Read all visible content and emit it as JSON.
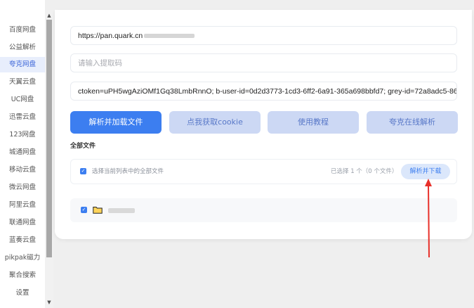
{
  "sidebar": {
    "items": [
      {
        "label": "百度网盘"
      },
      {
        "label": "公益解析"
      },
      {
        "label": "夸克网盘",
        "active": true
      },
      {
        "label": "天翼云盘"
      },
      {
        "label": "UC网盘"
      },
      {
        "label": "迅雷云盘"
      },
      {
        "label": "123网盘"
      },
      {
        "label": "城通网盘"
      },
      {
        "label": "移动云盘"
      },
      {
        "label": "微云网盘"
      },
      {
        "label": "阿里云盘"
      },
      {
        "label": "联通网盘"
      },
      {
        "label": "蓝奏云盘"
      },
      {
        "label": "pikpak磁力"
      },
      {
        "label": "聚合搜索"
      },
      {
        "label": "设置"
      }
    ]
  },
  "form": {
    "url_value": "https://pan.quark.cn",
    "code_placeholder": "请输入提取码",
    "cookie_value": "ctoken=uPH5wgAziOMf1Gq38LmbRnnO; b-user-id=0d2d3773-1cd3-6ff2-6a91-365a698bbfd7; grey-id=72a8adc5-8645-26("
  },
  "buttons": {
    "parse": "解析并加载文件",
    "cookie": "点我获取cookie",
    "tutorial": "使用教程",
    "online": "夸克在线解析"
  },
  "files": {
    "section_title": "全部文件",
    "select_all_label": "选择当前列表中的全部文件",
    "selected_count": "已选择 1 个（0 个文件）",
    "download_button": "解析并下载"
  },
  "colors": {
    "primary": "#3c7ef0",
    "arrow": "#e8302a"
  }
}
